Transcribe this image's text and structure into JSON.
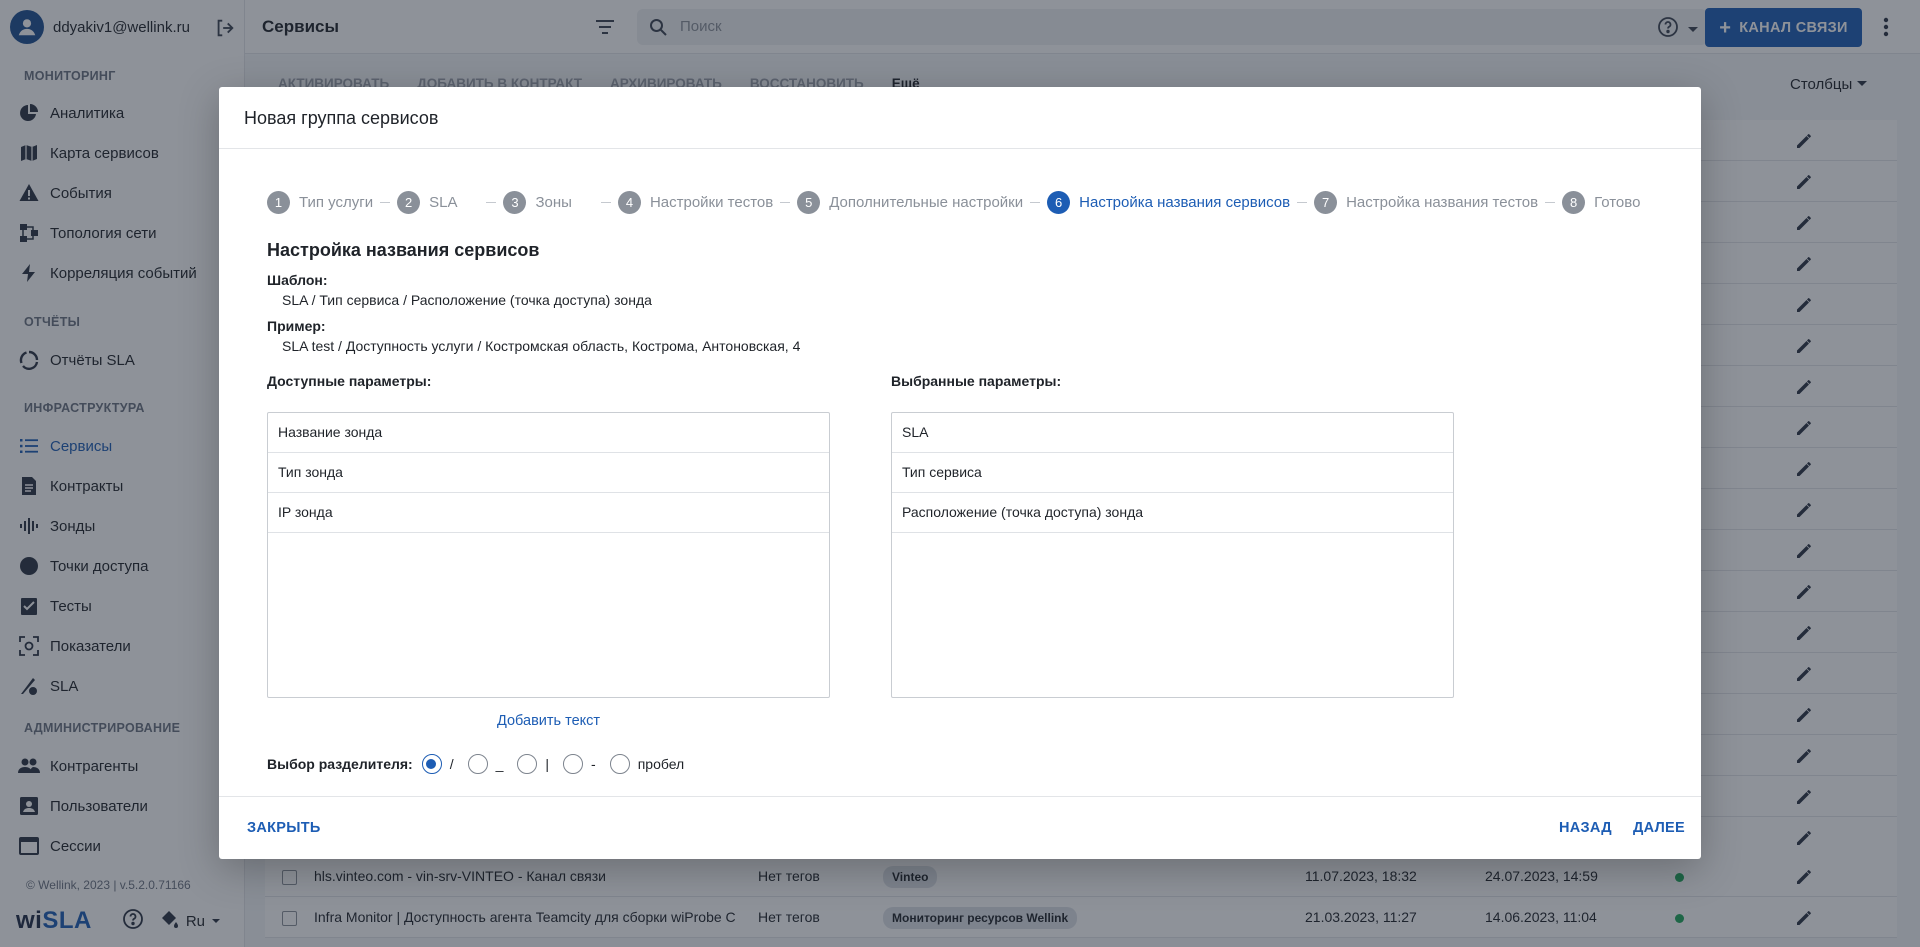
{
  "user": {
    "email": "ddyakiv1@wellink.ru"
  },
  "nav": {
    "monitoring_title": "МОНИТОРИНГ",
    "monitoring": [
      {
        "label": "Аналитика",
        "icon": "pie-chart-icon"
      },
      {
        "label": "Карта сервисов",
        "icon": "map-icon"
      },
      {
        "label": "События",
        "icon": "warning-icon"
      },
      {
        "label": "Топология сети",
        "icon": "topology-icon"
      },
      {
        "label": "Корреляция событий",
        "icon": "bolt-icon"
      }
    ],
    "reports_title": "ОТЧЁТЫ",
    "reports": [
      {
        "label": "Отчёты SLA",
        "icon": "refresh-circle-icon"
      }
    ],
    "infra_title": "ИНФРАСТРУКТУРА",
    "infra": [
      {
        "label": "Сервисы",
        "icon": "list-icon",
        "active": true
      },
      {
        "label": "Контракты",
        "icon": "document-icon"
      },
      {
        "label": "Зонды",
        "icon": "signal-icon"
      },
      {
        "label": "Точки доступа",
        "icon": "circle-icon"
      },
      {
        "label": "Тесты",
        "icon": "checklist-icon"
      },
      {
        "label": "Показатели",
        "icon": "metrics-icon"
      },
      {
        "label": "SLA",
        "icon": "sla-icon"
      }
    ],
    "admin_title": "АДМИНИСТРИРОВАНИЕ",
    "admin": [
      {
        "label": "Контрагенты",
        "icon": "people-icon"
      },
      {
        "label": "Пользователи",
        "icon": "user-card-icon"
      },
      {
        "label": "Сессии",
        "icon": "window-icon"
      }
    ]
  },
  "footer": {
    "version": "© Wellink, 2023 | v.5.2.0.71166",
    "logo_a": "wi",
    "logo_b": "SLA",
    "lang": "Ru"
  },
  "header": {
    "title": "Сервисы",
    "search_placeholder": "Поиск",
    "channel_button": "КАНАЛ СВЯЗИ"
  },
  "toolbar": {
    "activate": "АКТИВИРОВАТЬ",
    "add_contract": "ДОБАВИТЬ В КОНТРАКТ",
    "archive": "АРХИВИРОВАТЬ",
    "restore": "ВОССТАНОВИТЬ",
    "more": "Ещё",
    "columns": "Столбцы"
  },
  "rows": [
    {
      "name": "hls.vinteo.com - vin-srv-VINTEO - Канал связи",
      "tags": "Нет тегов",
      "contract": "Vinteo",
      "created": "11.07.2023, 18:32",
      "updated": "24.07.2023, 14:59"
    },
    {
      "name": "Infra Monitor | Доступность агента Teamcity для сборки wiProbe C",
      "tags": "Нет тегов",
      "contract": "Мониторинг ресурсов Wellink",
      "created": "21.03.2023, 11:27",
      "updated": "14.06.2023, 11:04"
    }
  ],
  "modal": {
    "title": "Новая группа сервисов",
    "steps": [
      {
        "n": "1",
        "label": "Тип услуги"
      },
      {
        "n": "2",
        "label": "SLA"
      },
      {
        "n": "3",
        "label": "Зоны"
      },
      {
        "n": "4",
        "label": "Настройки тестов"
      },
      {
        "n": "5",
        "label": "Дополнительные настройки"
      },
      {
        "n": "6",
        "label": "Настройка названия сервисов",
        "active": true
      },
      {
        "n": "7",
        "label": "Настройка названия тестов"
      },
      {
        "n": "8",
        "label": "Готово"
      }
    ],
    "heading": "Настройка названия сервисов",
    "template_label": "Шаблон:",
    "template_value": "SLA / Тип сервиса / Расположение (точка доступа) зонда",
    "example_label": "Пример:",
    "example_value": "SLA test / Доступность услуги / Костромская область, Кострома, Антоновская, 4",
    "available_label": "Доступные параметры:",
    "available": [
      "Название зонда",
      "Тип зонда",
      "IP зонда"
    ],
    "selected_label": "Выбранные параметры:",
    "selected": [
      "SLA",
      "Тип сервиса",
      "Расположение (точка доступа) зонда"
    ],
    "add_text": "Добавить текст",
    "separator_label": "Выбор разделителя:",
    "separators": [
      {
        "label": "/",
        "checked": true
      },
      {
        "label": "_",
        "checked": false
      },
      {
        "label": "|",
        "checked": false
      },
      {
        "label": "-",
        "checked": false
      },
      {
        "label": "пробел",
        "checked": false
      }
    ],
    "close": "ЗАКРЫТЬ",
    "back": "НАЗАД",
    "next": "ДАЛЕЕ"
  },
  "colors": {
    "accent": "#1d5db4",
    "status_ok": "#1fa65a"
  }
}
